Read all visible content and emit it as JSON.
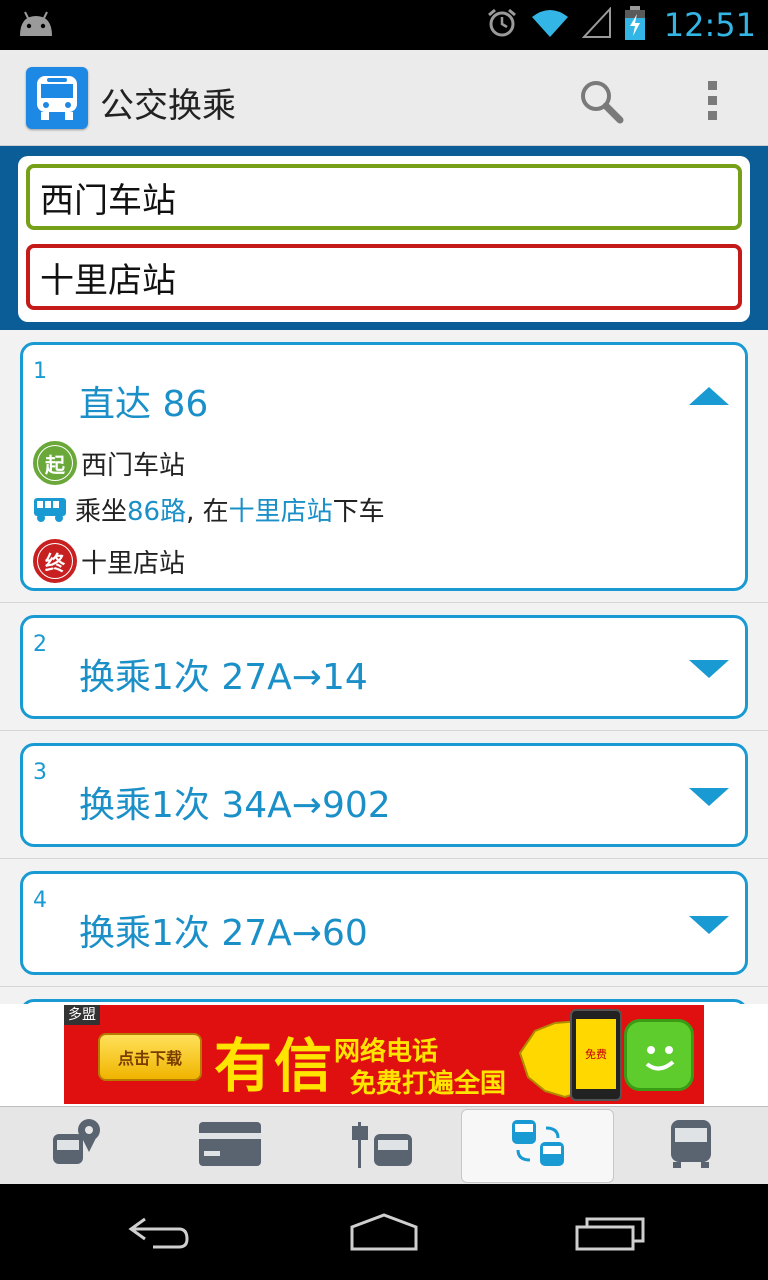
{
  "status_bar": {
    "time": "12:51",
    "icons": [
      "android-icon",
      "alarm-icon",
      "wifi-icon",
      "signal-icon",
      "battery-charging-icon"
    ]
  },
  "action_bar": {
    "title": "公交换乘",
    "icons": [
      "bus-app-icon",
      "search-icon",
      "overflow-menu-icon"
    ]
  },
  "search": {
    "from_value": "西门车站",
    "to_value": "十里店站"
  },
  "routes": [
    {
      "number": "1",
      "title": "直达 86",
      "expanded": true,
      "steps": {
        "start_badge": "起",
        "start_label": "西门车站",
        "ride_prefix": "乘坐",
        "ride_line": "86路",
        "ride_mid": ", 在",
        "ride_stop": "十里店站",
        "ride_suffix": "下车",
        "end_badge": "终",
        "end_label": "十里店站"
      }
    },
    {
      "number": "2",
      "title": "换乘1次 27A→14",
      "expanded": false
    },
    {
      "number": "3",
      "title": "换乘1次 34A→902",
      "expanded": false
    },
    {
      "number": "4",
      "title": "换乘1次 27A→60",
      "expanded": false
    }
  ],
  "ad": {
    "tag": "多盟",
    "download": "点击下载",
    "brand": "有信",
    "line1": "网络电话",
    "line2": "免费打遍全国",
    "phone_text": "免费"
  },
  "tabs": [
    {
      "icon": "bus-location-icon",
      "active": false
    },
    {
      "icon": "bus-card-icon",
      "active": false
    },
    {
      "icon": "bus-stop-icon",
      "active": false
    },
    {
      "icon": "transfer-icon",
      "active": true
    },
    {
      "icon": "bus-line-icon",
      "active": false
    }
  ],
  "nav_bar": {
    "icons": [
      "back-icon",
      "home-icon",
      "recent-apps-icon"
    ]
  },
  "colors": {
    "accent": "#1a9ad2",
    "from_border": "#77a019",
    "to_border": "#c41a1a",
    "panel_bg": "#0b5d98",
    "clock": "#33b5e5"
  }
}
